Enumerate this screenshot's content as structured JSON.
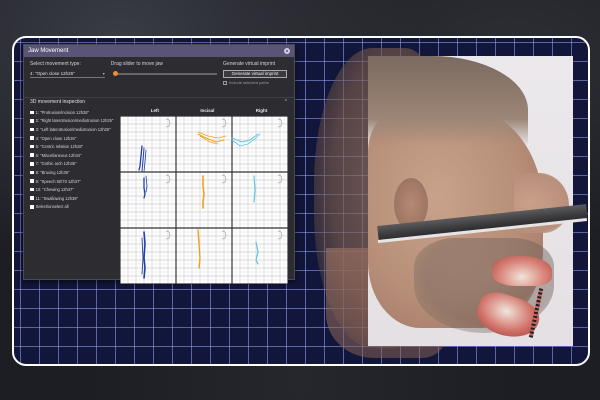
{
  "window": {
    "title": "Jaw Movement",
    "settings_icon": "gear-icon"
  },
  "controls": {
    "movement_type_label": "Select movement type:",
    "movement_type_value": "4: \"Open close 12h26\"",
    "slider_label": "Drag slider to move jaw",
    "slider_position": 0.0,
    "imprint_label": "Generate virtual imprint",
    "imprint_button": "Generate virtual imprint",
    "include_paths_label": "Include selected paths",
    "include_paths_checked": false
  },
  "inspection": {
    "title": "3D movement inspection",
    "collapse_icon": "chevron-up-icon",
    "items": [
      "1: \"Protrusion/incision 12h28\"",
      "2: \"Right laterotrusion/mediotrusion 12h25\"",
      "3: \"Left laterotrusion/mediotrusion 12h26\"",
      "4: \"Open close 12h26\"",
      "5: \"Centric relation 12h28\"",
      "6: \"Miscellaneous 12h34\"",
      "7: \"Gothic arch 12h36\"",
      "8: \"Bruxing 12h36\"",
      "9: \"Speech 50/70 12h37\"",
      "10: \"Chewing 12h37\"",
      "11: \"Swallowing 12h39\""
    ],
    "select_all_label": "Select/unselect all",
    "columns": [
      "Left",
      "Incisal",
      "Right"
    ]
  },
  "colors": {
    "left": "#1d3fa8",
    "incisal": "#f0a020",
    "right": "#5ec3e6",
    "frame_bg": "#12163a",
    "titlebar": "#5a5477"
  }
}
